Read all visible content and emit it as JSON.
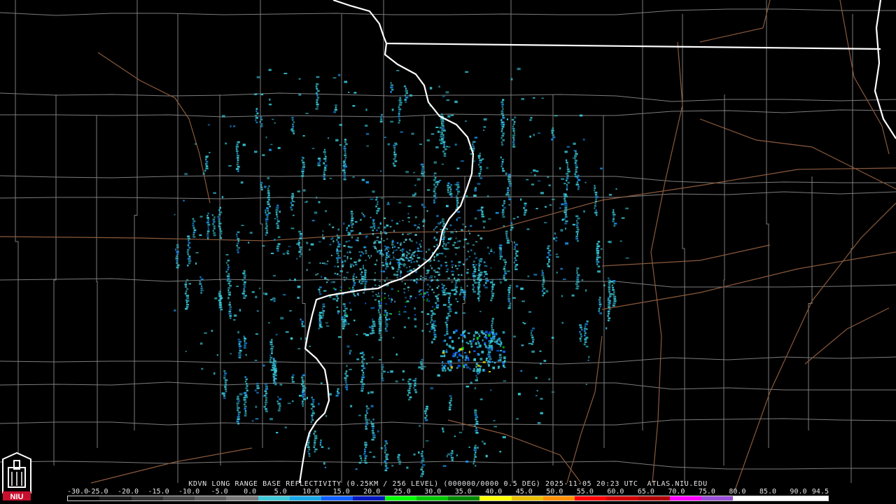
{
  "radar": {
    "title": "KDVN LONG RANGE BASE REFLECTIVITY (0.25KM / 256 LEVEL) (000000/0000 0.5 DEG) 2025-11-05 20:23 UTC  ATLAS.NIU.EDU"
  },
  "logo": {
    "text": "NIU",
    "color": "#c8102e"
  },
  "scale": {
    "labels": [
      "-30.0",
      "-25.0",
      "-20.0",
      "-15.0",
      "-10.0",
      "-5.0",
      "0.0",
      "5.0",
      "10.0",
      "15.0",
      "20.0",
      "25.0",
      "30.0",
      "35.0",
      "40.0",
      "45.0",
      "50.0",
      "55.0",
      "60.0",
      "65.0",
      "70.0",
      "75.0",
      "80.0",
      "85.0",
      "90.0",
      "94.5"
    ],
    "colors": [
      "#000000",
      "#1a1a1a",
      "#303030",
      "#474747",
      "#5e5e5e",
      "#7a7a7a",
      "#40c8d8",
      "#18a8e8",
      "#1060ff",
      "#0018c0",
      "#00ff00",
      "#00c800",
      "#008800",
      "#ffff00",
      "#e8c000",
      "#ff9000",
      "#ff0000",
      "#d00000",
      "#b00000",
      "#ff00ff",
      "#9a50d8",
      "#ffffff",
      "#ffffff",
      "#ffffff"
    ]
  },
  "colors": {
    "background": "#000000",
    "county_lines": "#7c7c7c",
    "state_lines": "#ffffff",
    "highways": "#8a5a3c",
    "echo_primary": "#37c6d6",
    "echo_secondary": "#1a8ee6"
  }
}
